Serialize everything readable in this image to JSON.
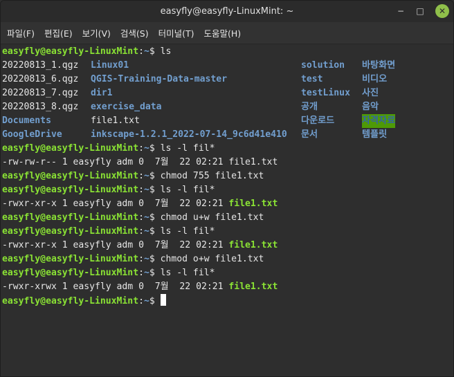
{
  "window": {
    "title": "easyfly@easyfly-LinuxMint: ~",
    "controls": {
      "minimize": "−",
      "maximize": "□",
      "close": "✕"
    }
  },
  "menu": [
    "파일(F)",
    "편집(E)",
    "보기(V)",
    "검색(S)",
    "터미널(T)",
    "도움말(H)"
  ],
  "prompt": {
    "user": "easyfly@easyfly-LinuxMint",
    "sep": ":",
    "path": "~",
    "sym": "$"
  },
  "commands": {
    "ls": " ls",
    "ls_l_1": " ls -l fil*",
    "chmod_755": " chmod 755 file1.txt",
    "ls_l_2": " ls -l fil*",
    "chmod_uw": " chmod u+w file1.txt",
    "ls_l_3": " ls -l fil*",
    "chmod_ow": " chmod o+w file1.txt",
    "ls_l_4": " ls -l fil*"
  },
  "ls_output": {
    "rows": [
      [
        "20220813_1.qgz",
        "Linux01",
        "solution",
        "바탕화면"
      ],
      [
        "20220813_6.qgz",
        "QGIS-Training-Data-master",
        "test",
        "비디오"
      ],
      [
        "20220813_7.qgz",
        "dir1",
        "testLinux",
        "사진"
      ],
      [
        "20220813_8.qgz",
        "exercise_data",
        "공개",
        "음악"
      ],
      [
        "Documents",
        "file1.txt",
        "다운로드",
        "자격자료"
      ],
      [
        "GoogleDrive",
        "inkscape-1.2.1_2022-07-14_9c6d41e410",
        "문서",
        "템플릿"
      ]
    ]
  },
  "listings": {
    "l1": {
      "prefix": "-rw-rw-r-- 1 easyfly adm 0  7월  22 02:21 ",
      "file": "file1.txt"
    },
    "l2": {
      "prefix": "-rwxr-xr-x 1 easyfly adm 0  7월  22 02:21 ",
      "file": "file1.txt"
    },
    "l3": {
      "prefix": "-rwxr-xr-x 1 easyfly adm 0  7월  22 02:21 ",
      "file": "file1.txt"
    },
    "l4": {
      "prefix": "-rwxr-xrwx 1 easyfly adm 0  7월  22 02:21 ",
      "file": "file1.txt"
    }
  },
  "colors": {
    "prompt_green": "#8ae234",
    "path_blue": "#729fcf",
    "highlight_bg": "#4e9a06",
    "close_button": "#8fbf4a",
    "background": "#2e2e2e"
  }
}
